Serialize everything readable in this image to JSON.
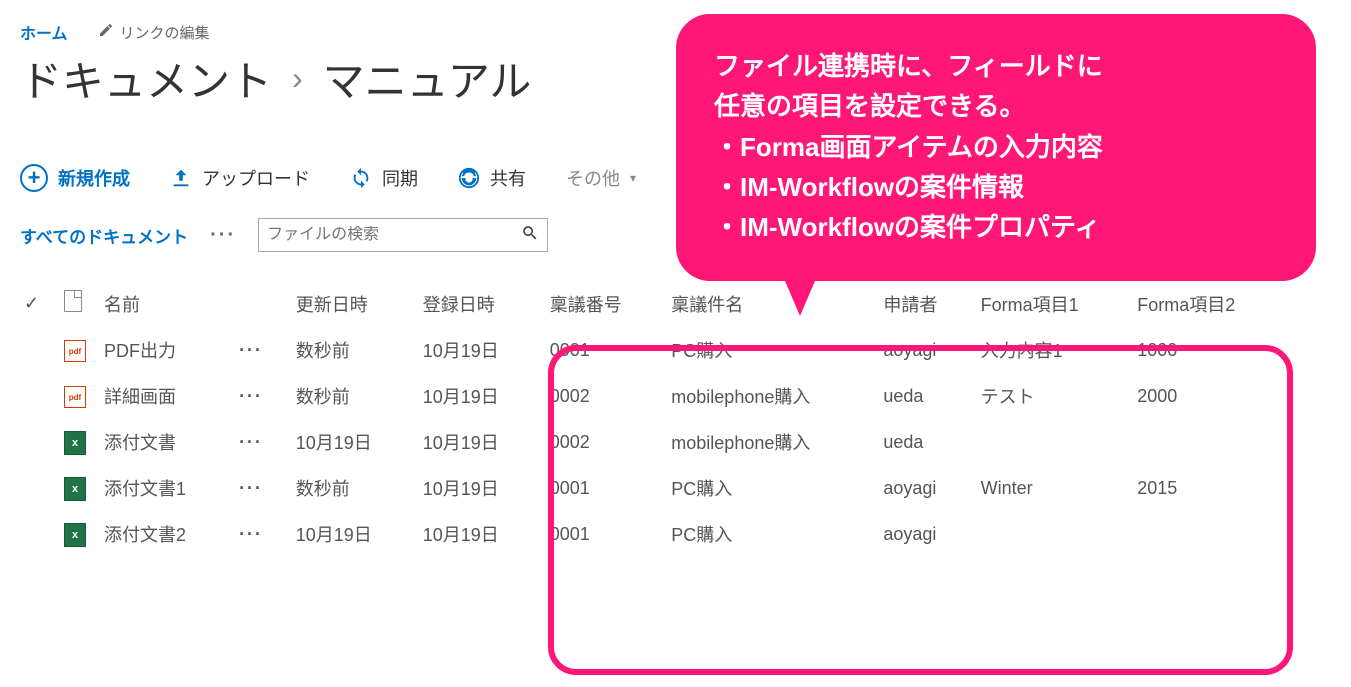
{
  "breadcrumb": {
    "home": "ホーム",
    "edit_links": "リンクの編集"
  },
  "title": {
    "library": "ドキュメント",
    "folder": "マニュアル"
  },
  "toolbar": {
    "new_label": "新規作成",
    "upload_label": "アップロード",
    "sync_label": "同期",
    "share_label": "共有",
    "other_label": "その他"
  },
  "view": {
    "label": "すべてのドキュメント"
  },
  "search": {
    "placeholder": "ファイルの検索"
  },
  "columns": {
    "name": "名前",
    "modified": "更新日時",
    "registered": "登録日時",
    "ringi_no": "稟議番号",
    "ringi_title": "稟議件名",
    "applicant": "申請者",
    "forma1": "Forma項目1",
    "forma2": "Forma項目2"
  },
  "rows": [
    {
      "icon": "pdf",
      "name": "PDF出力",
      "modified": "数秒前",
      "registered": "10月19日",
      "ringi_no": "0001",
      "ringi_title": "PC購入",
      "applicant": "aoyagi",
      "forma1": "入力内容1",
      "forma2": "1000"
    },
    {
      "icon": "pdf",
      "name": "詳細画面",
      "modified": "数秒前",
      "registered": "10月19日",
      "ringi_no": "0002",
      "ringi_title": "mobilephone購入",
      "applicant": "ueda",
      "forma1": "テスト",
      "forma2": "2000"
    },
    {
      "icon": "xls",
      "name": "添付文書",
      "modified": "10月19日",
      "registered": "10月19日",
      "ringi_no": "0002",
      "ringi_title": "mobilephone購入",
      "applicant": "ueda",
      "forma1": "",
      "forma2": ""
    },
    {
      "icon": "xls",
      "name": "添付文書1",
      "modified": "数秒前",
      "registered": "10月19日",
      "ringi_no": "0001",
      "ringi_title": "PC購入",
      "applicant": "aoyagi",
      "forma1": "Winter",
      "forma2": "2015"
    },
    {
      "icon": "xls",
      "name": "添付文書2",
      "modified": "10月19日",
      "registered": "10月19日",
      "ringi_no": "0001",
      "ringi_title": "PC購入",
      "applicant": "aoyagi",
      "forma1": "",
      "forma2": ""
    }
  ],
  "callout": {
    "line1": "ファイル連携時に、フィールドに",
    "line2": "任意の項目を設定できる。",
    "bullet1": "・Forma画面アイテムの入力内容",
    "bullet2": "・IM-Workflowの案件情報",
    "bullet3": "・IM-Workflowの案件プロパティ"
  }
}
